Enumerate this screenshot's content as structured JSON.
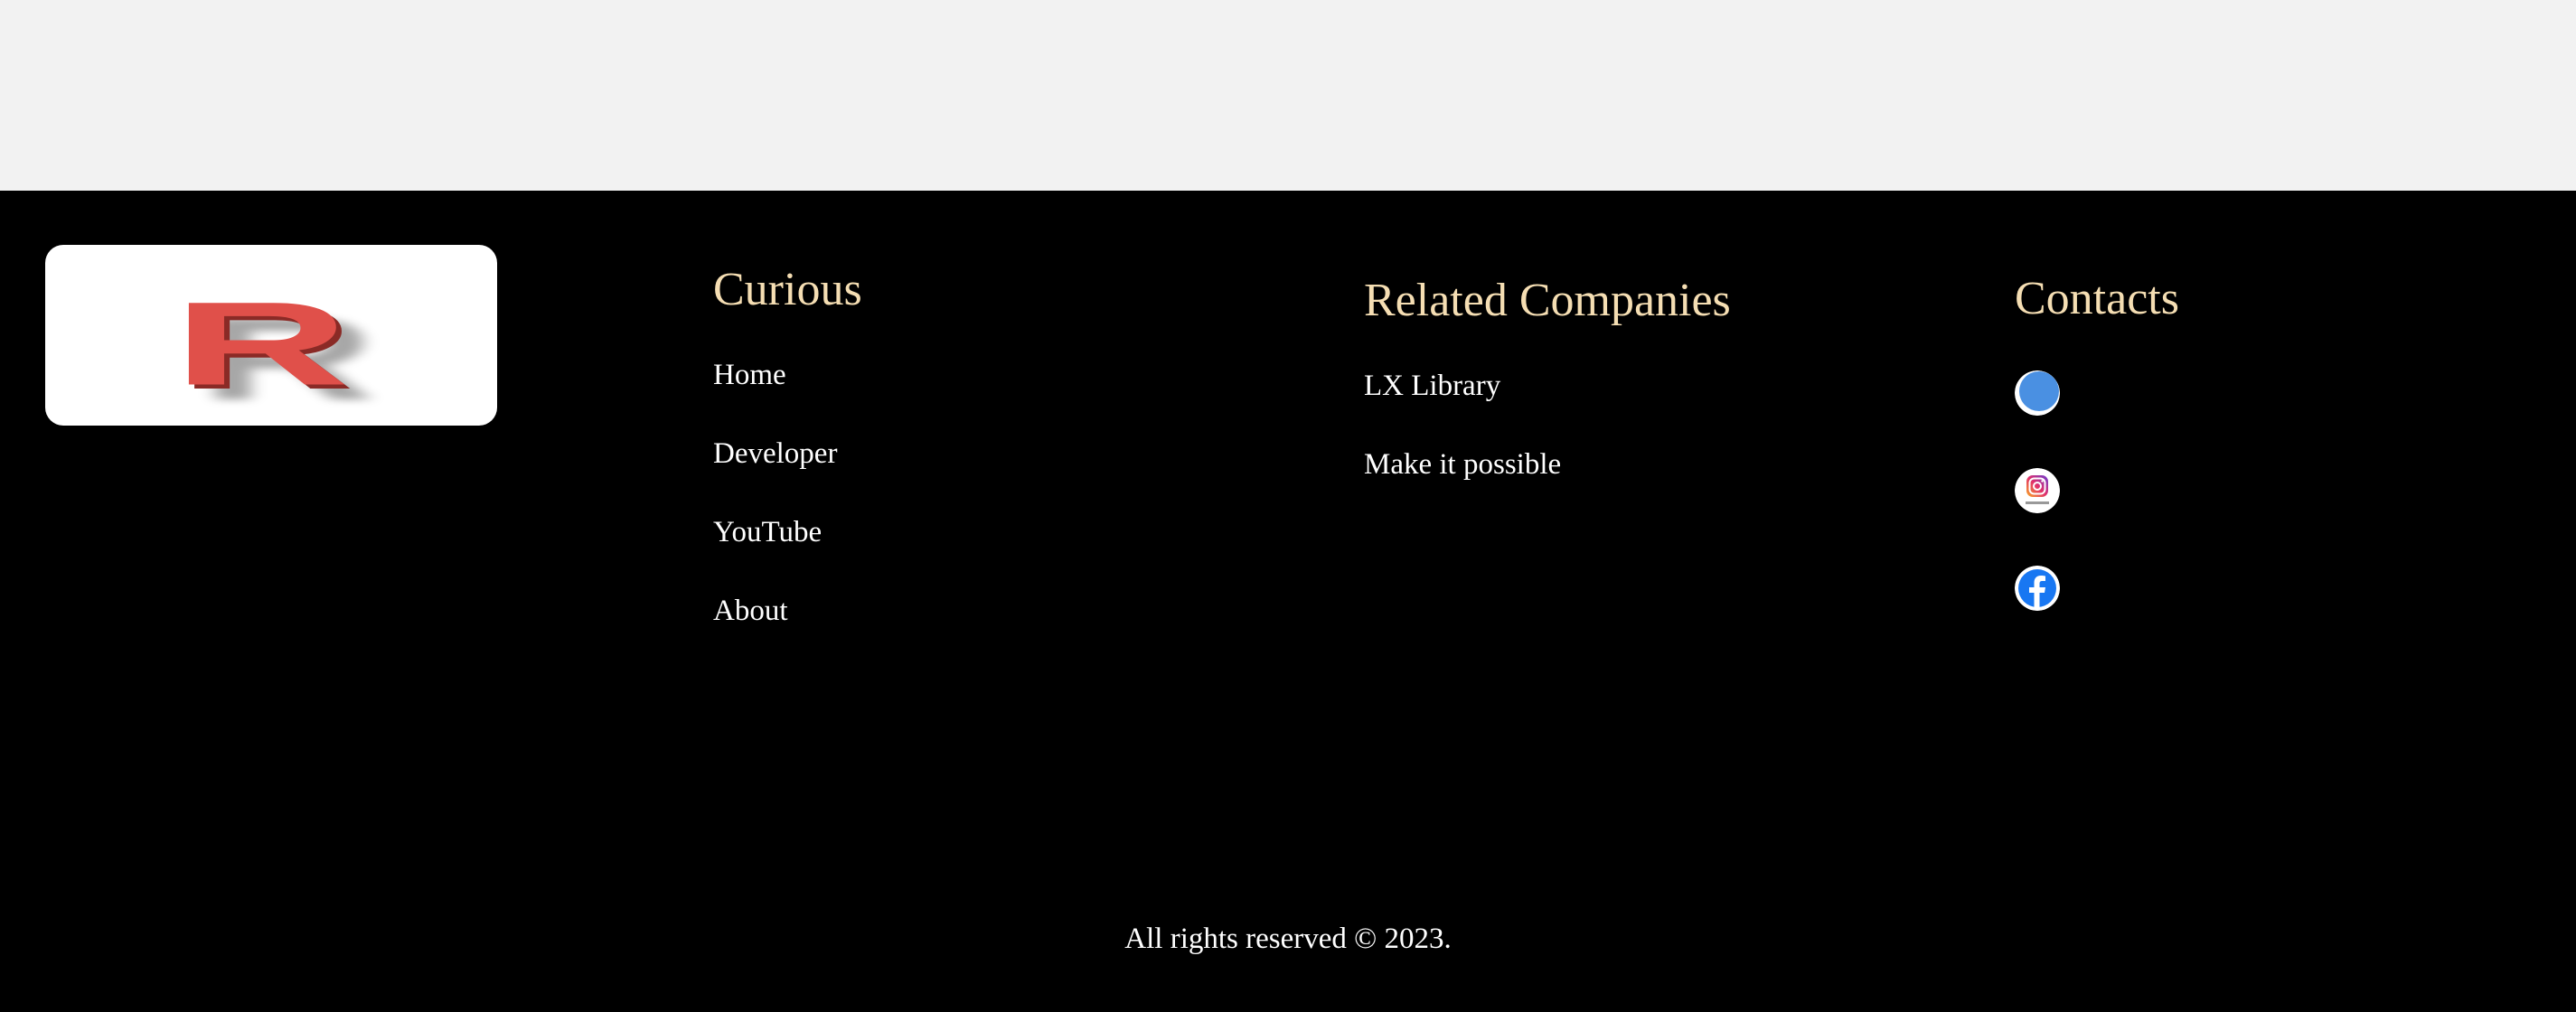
{
  "logo": {
    "letter": "R",
    "color": "#e0504a"
  },
  "columns": {
    "curious": {
      "heading": "Curious",
      "links": [
        "Home",
        "Developer",
        "YouTube",
        "About"
      ]
    },
    "related": {
      "heading": "Related Companies",
      "links": [
        "LX Library",
        "Make it possible"
      ]
    },
    "contacts": {
      "heading": "Contacts",
      "icons": [
        "twitter-icon",
        "instagram-icon",
        "facebook-icon"
      ]
    }
  },
  "colors": {
    "footer_bg": "#000000",
    "top_bg": "#f2f2f2",
    "heading": "#f5deb3",
    "link": "#ffffff",
    "twitter": "#4a90e2",
    "facebook": "#1877f2"
  },
  "copyright": "All rights reserved © 2023."
}
